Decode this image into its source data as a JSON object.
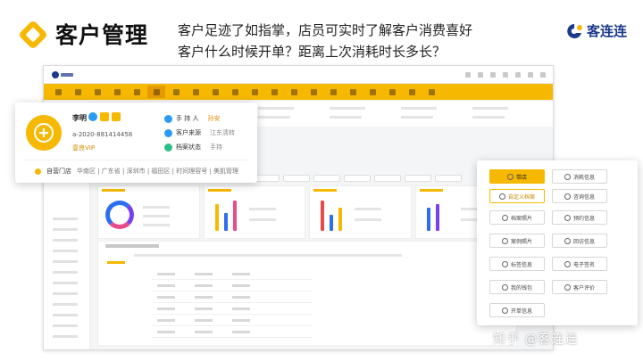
{
  "header": {
    "title": "客户管理",
    "headline_line1": "客户足迹了如指掌，店员可实时了解客户消费喜好",
    "headline_line2": "客户什么时候开单？距离上次消耗时长多长？",
    "brand": "客连连",
    "accent_color": "#f6b800",
    "brand_color": "#1b3a8c"
  },
  "customer_card": {
    "name": "李明",
    "id": "a-2020-881414458",
    "level": "壹良VIP",
    "fields": [
      {
        "icon": "hand-icon",
        "label": "手 持 人",
        "value": "孙安",
        "value_color": "orange"
      },
      {
        "icon": "source-icon",
        "label": "客户来源",
        "value": "江东清转",
        "value_color": "gray"
      },
      {
        "icon": "status-icon",
        "label": "档案状态",
        "value": "手持",
        "value_color": "gray"
      }
    ],
    "store": "自营门店",
    "store_path": "华南区 | 广东省 | 深圳市 | 福田区 | 时间理容号 | 美肌管理"
  },
  "action_panel": {
    "buttons": [
      {
        "label": "带店",
        "style": "primary",
        "icon": "store-icon"
      },
      {
        "label": "消耗信息",
        "style": "normal",
        "icon": "consume-icon"
      },
      {
        "label": "自定义档案",
        "style": "highlight",
        "icon": "profile-icon"
      },
      {
        "label": "咨询信息",
        "style": "normal",
        "icon": "chat-icon"
      },
      {
        "label": "档案照片",
        "style": "normal",
        "icon": "photo-icon"
      },
      {
        "label": "预约信息",
        "style": "normal",
        "icon": "clock-icon"
      },
      {
        "label": "案例照片",
        "style": "normal",
        "icon": "case-icon"
      },
      {
        "label": "回访信息",
        "style": "normal",
        "icon": "phone-icon"
      },
      {
        "label": "标签信息",
        "style": "normal",
        "icon": "tag-icon"
      },
      {
        "label": "电子签名",
        "style": "normal",
        "icon": "sign-icon"
      },
      {
        "label": "我的钱包",
        "style": "normal",
        "icon": "wallet-icon"
      },
      {
        "label": "客户评价",
        "style": "normal",
        "icon": "user-icon"
      },
      {
        "label": "开单信息",
        "style": "normal",
        "icon": "order-icon"
      }
    ]
  },
  "watermark": "知乎 @客连连"
}
